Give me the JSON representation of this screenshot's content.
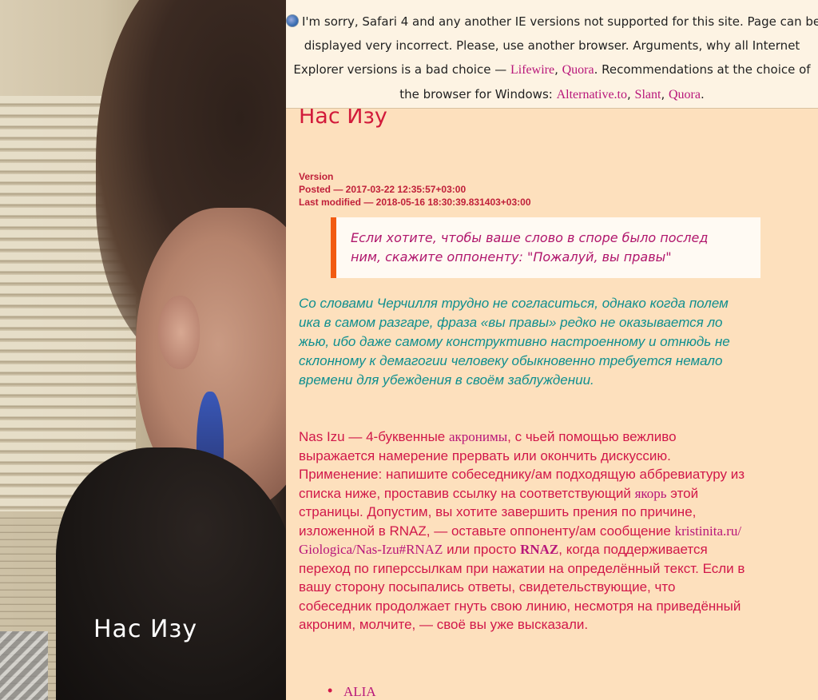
{
  "warning": {
    "text1": "I'm sorry, Safari 4 and any another IE versions not supported for this site. Page can be",
    "text2": "displayed very incorrect. Please, use another browser. Arguments, why all Internet",
    "text3a": "Explorer versions is a bad choice — ",
    "link_lifewire": "Lifewire",
    "sep1": ", ",
    "link_quora1": "Quora",
    "text3b": ". Recommendations at the choice of",
    "text4a": "the browser for Windows: ",
    "link_alternative": "Alternative.to",
    "sep2": ", ",
    "link_slant": "Slant",
    "sep3": ", ",
    "link_quora2": "Quora",
    "text4b": "."
  },
  "photo": {
    "caption": "Нас Изу"
  },
  "page": {
    "title": "Нас Изу",
    "version_label": "Version",
    "posted": "Posted — 2017-03-22 12:35:57+03:00",
    "modified": "Last modified — 2018-05-16 18:30:39.831403+03:00"
  },
  "quote": {
    "line1": "Если хотите, чтобы ваше слово в споре было послед",
    "line2": "ним, скажите оппоненту: \"Пожалуй, вы правы\""
  },
  "intro": {
    "line1": "Со словами Черчилля трудно не согласиться, однако когда полем",
    "line2": "ика в самом разгаре, фраза «вы правы» редко не оказывается ло",
    "line3": "жью, ибо даже самому конструктивно настроенному и отнюдь не",
    "line4": "склонному к демагогии человеку обыкновенно требуется немало",
    "line5": "времени для убеждения в своём заблуждении."
  },
  "body": {
    "l1a": "Nas Izu — 4-буквенные ",
    "l1link": "акронимы",
    "l1b": ", с чьей помощью вежливо",
    "l2": "выражается намерение прервать или окончить дискуссию.",
    "l3": "Применение: напишите собеседнику/ам подходящую аббревиатуру из",
    "l4a": "списка ниже, проставив ссылку на соответствующий ",
    "l4link": "якорь",
    "l4b": " этой",
    "l5": "страницы. Допустим, вы хотите завершить прения по причине,",
    "l6a": "изложенной в RNAZ, — оставьте оппоненту/ам сообщение ",
    "l6link": "kristinita.ru/",
    "l7link": "Giologica/Nas-Izu#RNAZ",
    "l7a": " или просто ",
    "l7link2": "RNAZ",
    "l7b": ", когда поддерживается",
    "l8": "переход по гиперссылкам при нажатии на определённый текст. Если в",
    "l9": "вашу сторону посыпались ответы, свидетельствующие, что",
    "l10": "собеседник продолжает гнуть свою линию, несмотря на приведённый",
    "l11": "акроним, молчите, — своё вы уже высказали."
  },
  "list": {
    "item1": "ALIA"
  },
  "colors": {
    "background": "#fde0bd",
    "title": "#d21a3a",
    "link": "#b8167a",
    "quote_border": "#f25b12",
    "intro_text": "#0f8f8f"
  }
}
